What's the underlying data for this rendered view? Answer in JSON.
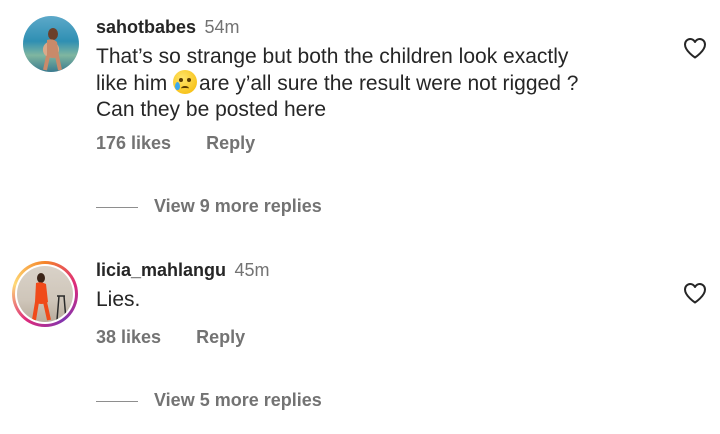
{
  "comments": [
    {
      "username": "sahotbabes",
      "time": "54m",
      "text_line1": "That’s so strange but both the children look exactly",
      "text_line2_before": "like him ",
      "text_line2_after": "are y’all sure the result were not rigged ?",
      "text_line3": "Can they be posted here",
      "emoji": "crying-face-emoji",
      "likes": "176 likes",
      "reply_label": "Reply",
      "view_replies": "View 9 more replies"
    },
    {
      "username": "licia_mahlangu",
      "time": "45m",
      "text": "Lies.",
      "likes": "38 likes",
      "reply_label": "Reply",
      "view_replies": "View 5 more replies"
    }
  ],
  "icons": {
    "like": "heart-outline-icon"
  },
  "colors": {
    "text": "#262626",
    "muted": "#737373",
    "story_ring": "#dd2a7b"
  }
}
